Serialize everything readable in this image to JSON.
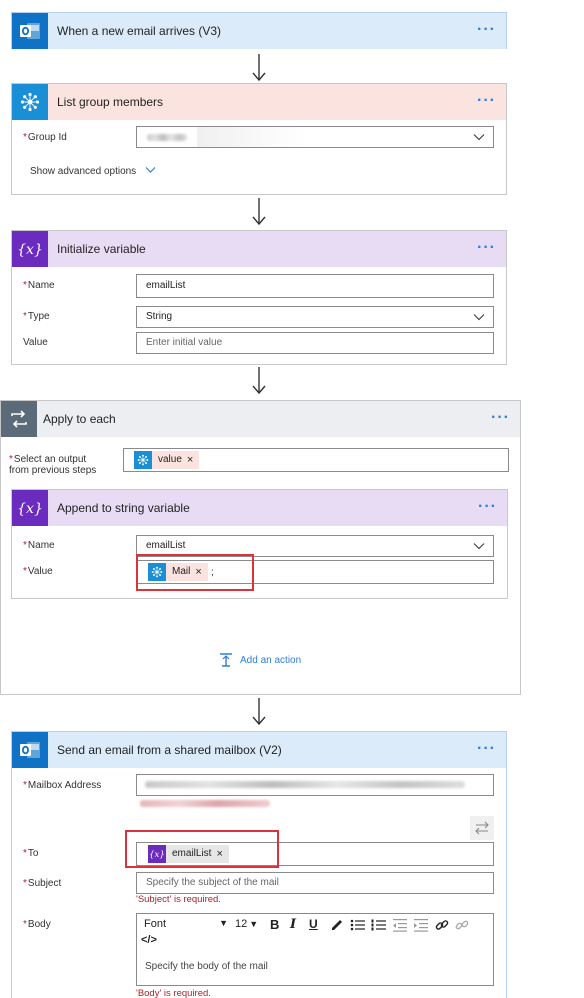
{
  "cards": {
    "trigger": {
      "title": "When a new email arrives (V3)",
      "more": "···"
    },
    "list_members": {
      "title": "List group members",
      "more": "···",
      "group_id_label": "Group Id",
      "advanced_label": "Show advanced options"
    },
    "init_var": {
      "title": "Initialize variable",
      "more": "···",
      "name_label": "Name",
      "name_value": "emailList",
      "type_label": "Type",
      "type_value": "String",
      "value_label": "Value",
      "value_placeholder": "Enter initial value"
    },
    "apply_each": {
      "title": "Apply to each",
      "more": "···",
      "select_label_1": "Select an output",
      "select_label_2": "from previous steps",
      "token_value": "value",
      "add_action": "Add an action"
    },
    "append": {
      "title": "Append to string variable",
      "more": "···",
      "name_label": "Name",
      "name_value": "emailList",
      "value_label": "Value",
      "token_mail": "Mail",
      "suffix": ";"
    },
    "send_email": {
      "title": "Send an email from a shared mailbox (V2)",
      "more": "···",
      "mailbox_label": "Mailbox Address",
      "to_label": "To",
      "to_token": "emailList",
      "subject_label": "Subject",
      "subject_placeholder": "Specify the subject of the mail",
      "subject_error": "'Subject' is required.",
      "body_label": "Body",
      "font_select": "Font",
      "size_select": "12",
      "body_placeholder": "Specify the body of the mail",
      "body_error": "'Body' is required.",
      "code_view": "</>"
    }
  },
  "colors": {
    "trigger_header": "#dcebfa",
    "connector_header": "#fbe3df",
    "variable_header": "#e8dcf4",
    "loop_header": "#eceef1",
    "outlook_blue": "#0f72c4",
    "connector_blue": "#1a8fd6",
    "variable_purple": "#6c2bbf",
    "link_blue": "#2e7fd5",
    "error_red": "#a4262c",
    "highlight_red": "#d9333b"
  },
  "icons": [
    "outlook-icon",
    "group-members-icon",
    "variable-icon",
    "loop-icon",
    "more-icon",
    "chevron-down-icon",
    "arrow-down-icon",
    "add-action-icon",
    "swap-icon"
  ]
}
